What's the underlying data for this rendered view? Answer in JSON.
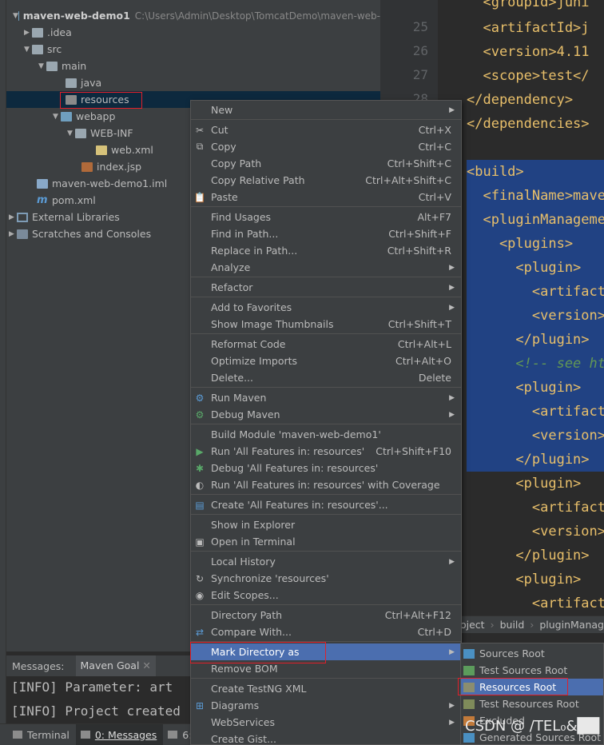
{
  "project_tree": {
    "root_name": "maven-web-demo1",
    "root_path": "C:\\Users\\Admin\\Desktop\\TomcatDemo\\maven-web-",
    "items": [
      {
        "label": ".idea"
      },
      {
        "label": "src"
      },
      {
        "label": "main"
      },
      {
        "label": "java"
      },
      {
        "label": "resources"
      },
      {
        "label": "webapp"
      },
      {
        "label": "WEB-INF"
      },
      {
        "label": "web.xml"
      },
      {
        "label": "index.jsp"
      },
      {
        "label": "maven-web-demo1.iml"
      },
      {
        "label": "pom.xml"
      },
      {
        "label": "External Libraries"
      },
      {
        "label": "Scratches and Consoles"
      }
    ]
  },
  "editor": {
    "line_numbers": [
      "25",
      "26",
      "27",
      "28"
    ],
    "lines": [
      {
        "text": "  <groupId>juni"
      },
      {
        "text": "  <artifactId>j"
      },
      {
        "text": "  <version>4.11"
      },
      {
        "text": "  <scope>test</"
      },
      {
        "text": "</dependency>"
      },
      {
        "text": "</dependencies>"
      },
      {
        "text": ""
      },
      {
        "text": "<build>"
      },
      {
        "text": "  <finalName>mave"
      },
      {
        "text": "  <pluginManageme"
      },
      {
        "text": "    <plugins>"
      },
      {
        "text": "      <plugin>"
      },
      {
        "text": "        <artifact"
      },
      {
        "text": "        <version>"
      },
      {
        "text": "      </plugin>"
      },
      {
        "text": "      <!-- see ht"
      },
      {
        "text": "      <plugin>"
      },
      {
        "text": "        <artifact"
      },
      {
        "text": "        <version>"
      },
      {
        "text": "      </plugin>"
      },
      {
        "text": "      <plugin>"
      },
      {
        "text": "        <artifact"
      },
      {
        "text": "        <version>"
      },
      {
        "text": "      </plugin>"
      },
      {
        "text": "      <plugin>"
      },
      {
        "text": "        <artifact"
      }
    ]
  },
  "breadcrumb": [
    "oject",
    "build",
    "pluginManag"
  ],
  "messages": {
    "title": "Messages:",
    "tab": "Maven Goal",
    "lines": [
      "[INFO] Parameter: art",
      "[INFO] Project created"
    ]
  },
  "tool_tabs": [
    {
      "label": "Terminal"
    },
    {
      "label": "0: Messages"
    },
    {
      "label": "6: T"
    }
  ],
  "context_menu": {
    "items": [
      {
        "label": "New",
        "shortcut": "",
        "submenu": true
      },
      {
        "label": "Cut",
        "shortcut": "Ctrl+X"
      },
      {
        "label": "Copy",
        "shortcut": "Ctrl+C"
      },
      {
        "label": "Copy Path",
        "shortcut": "Ctrl+Shift+C"
      },
      {
        "label": "Copy Relative Path",
        "shortcut": "Ctrl+Alt+Shift+C"
      },
      {
        "label": "Paste",
        "shortcut": "Ctrl+V"
      },
      {
        "label": "Find Usages",
        "shortcut": "Alt+F7"
      },
      {
        "label": "Find in Path...",
        "shortcut": "Ctrl+Shift+F"
      },
      {
        "label": "Replace in Path...",
        "shortcut": "Ctrl+Shift+R"
      },
      {
        "label": "Analyze",
        "shortcut": "",
        "submenu": true
      },
      {
        "label": "Refactor",
        "shortcut": "",
        "submenu": true
      },
      {
        "label": "Add to Favorites",
        "shortcut": "",
        "submenu": true
      },
      {
        "label": "Show Image Thumbnails",
        "shortcut": "Ctrl+Shift+T"
      },
      {
        "label": "Reformat Code",
        "shortcut": "Ctrl+Alt+L"
      },
      {
        "label": "Optimize Imports",
        "shortcut": "Ctrl+Alt+O"
      },
      {
        "label": "Delete...",
        "shortcut": "Delete"
      },
      {
        "label": "Run Maven",
        "shortcut": "",
        "submenu": true
      },
      {
        "label": "Debug Maven",
        "shortcut": "",
        "submenu": true
      },
      {
        "label": "Build Module 'maven-web-demo1'",
        "shortcut": ""
      },
      {
        "label": "Run 'All Features in: resources'",
        "shortcut": "Ctrl+Shift+F10"
      },
      {
        "label": "Debug 'All Features in: resources'",
        "shortcut": ""
      },
      {
        "label": "Run 'All Features in: resources' with Coverage",
        "shortcut": ""
      },
      {
        "label": "Create 'All Features in: resources'...",
        "shortcut": ""
      },
      {
        "label": "Show in Explorer",
        "shortcut": ""
      },
      {
        "label": "Open in Terminal",
        "shortcut": ""
      },
      {
        "label": "Local History",
        "shortcut": "",
        "submenu": true
      },
      {
        "label": "Synchronize 'resources'",
        "shortcut": ""
      },
      {
        "label": "Edit Scopes...",
        "shortcut": ""
      },
      {
        "label": "Directory Path",
        "shortcut": "Ctrl+Alt+F12"
      },
      {
        "label": "Compare With...",
        "shortcut": "Ctrl+D"
      },
      {
        "label": "Mark Directory as",
        "shortcut": "",
        "submenu": true
      },
      {
        "label": "Remove BOM",
        "shortcut": ""
      },
      {
        "label": "Create TestNG XML",
        "shortcut": ""
      },
      {
        "label": "Diagrams",
        "shortcut": "",
        "submenu": true
      },
      {
        "label": "WebServices",
        "shortcut": "",
        "submenu": true
      },
      {
        "label": "Create Gist...",
        "shortcut": ""
      }
    ]
  },
  "submenu": {
    "items": [
      {
        "label": "Sources Root",
        "color": "#4a90c2"
      },
      {
        "label": "Test Sources Root",
        "color": "#5c9c5c"
      },
      {
        "label": "Resources Root",
        "color": "#8b8d6f"
      },
      {
        "label": "Test Resources Root",
        "color": "#7f8b5a"
      },
      {
        "label": "Excluded",
        "color": "#c27a3a"
      },
      {
        "label": "Generated Sources Root",
        "color": "#4a90c2"
      }
    ]
  },
  "watermark": "CSDN @ ∕TEL₀&██",
  "colors": {
    "selection": "#4b6eaf",
    "highlight_box": "#e0202a",
    "code_selection": "#214283"
  }
}
